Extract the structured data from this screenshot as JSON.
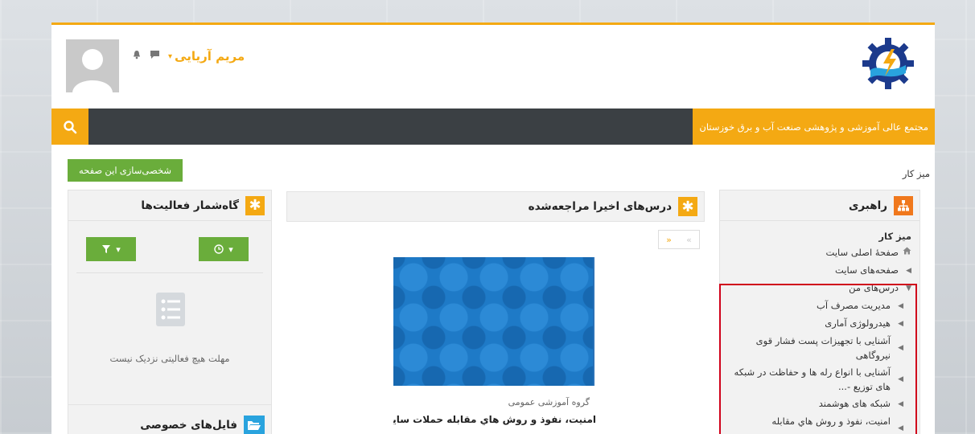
{
  "header": {
    "user_name": "مریم آریایی",
    "caret": "▾"
  },
  "navbar": {
    "brand": "مجتمع عالی آموزشی و پژوهشی صنعت آب و برق خوزستان"
  },
  "breadcrumb": {
    "label": "میز کار"
  },
  "customize_button": "شخصی‌سازی این صفحه",
  "nav_block": {
    "title": "راهبری",
    "root": "میز کار",
    "items": [
      {
        "label": "صفحهٔ اصلی سایت",
        "icon": "home-icon",
        "level": 0
      },
      {
        "label": "صفحه‌های سایت",
        "icon": "arrow-left-icon",
        "level": 0
      },
      {
        "label": "درس‌های من",
        "icon": "arrow-down-icon",
        "level": 0
      },
      {
        "label": "مدیریت مصرف آب",
        "icon": "arrow-left-icon",
        "level": 1
      },
      {
        "label": "هیدرولوژی آماری",
        "icon": "arrow-left-icon",
        "level": 1
      },
      {
        "label": "آشنایی با تجهیزات پست فشار قوی نیروگاهی",
        "icon": "arrow-left-icon",
        "level": 1
      },
      {
        "label": "آشنایی با انواع رله ها و حفاظت در شبکه های توزیع -...",
        "icon": "arrow-left-icon",
        "level": 1
      },
      {
        "label": "شبکه های هوشمند",
        "icon": "arrow-left-icon",
        "level": 1
      },
      {
        "label": "امنیت، نفوذ و روش هاي مقابله",
        "icon": "arrow-left-icon",
        "level": 1
      }
    ]
  },
  "recent_block": {
    "title": "درس‌های اخیرا مراجعه‌شده",
    "pager_prev": "«",
    "pager_next": "»",
    "course": {
      "category": "گروه آموزشی عمومی",
      "name": "امنیت، نفوذ و روش هاي مقابله حملات سایبری"
    }
  },
  "timeline_block": {
    "title": "گاه‌شمار فعالیت‌ها",
    "empty_text": "مهلت هیچ فعالیتی نزدیک نیست",
    "filter_caret": "▾",
    "sort_caret": "▾"
  },
  "files_block": {
    "title": "فایل‌های خصوصی"
  },
  "colors": {
    "accent": "#f4a913",
    "navbar": "#3b4044",
    "green": "#6aad3b",
    "highlight": "#d0021b"
  }
}
